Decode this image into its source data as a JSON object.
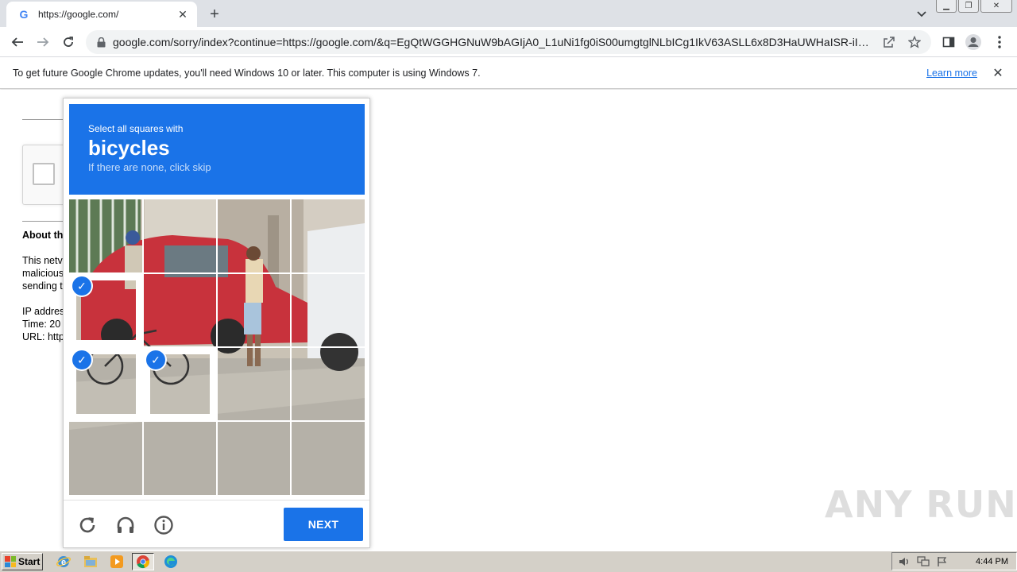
{
  "browser": {
    "tab_title": "https://google.com/",
    "tab_favicon": "G",
    "url": "google.com/sorry/index?continue=https://google.com/&q=EgQtWGGHGNuW9bAGIjA0_L1uNi1fg0iS00umgtglNLbICg1IkV63ASLL6x8D3HaUWHaISR-iI8ZO...",
    "infobar_text": "To get future Google Chrome updates, you'll need Windows 10 or later. This computer is using Windows 7.",
    "infobar_link": "Learn more"
  },
  "page": {
    "about_title": "About th",
    "about_lines": [
      "This netv",
      "malicious",
      "sending t",
      "",
      "IP addres",
      "Time: 20",
      "URL: http"
    ]
  },
  "challenge": {
    "instruction": "Select all squares with",
    "keyword": "bicycles",
    "hint": "If there are none, click skip",
    "next_label": "NEXT",
    "selected_tiles": [
      4,
      8,
      9
    ],
    "accent_color": "#1a73e8"
  },
  "watermark": "ANY RUN",
  "taskbar": {
    "start_label": "Start",
    "clock": "4:44 PM"
  }
}
